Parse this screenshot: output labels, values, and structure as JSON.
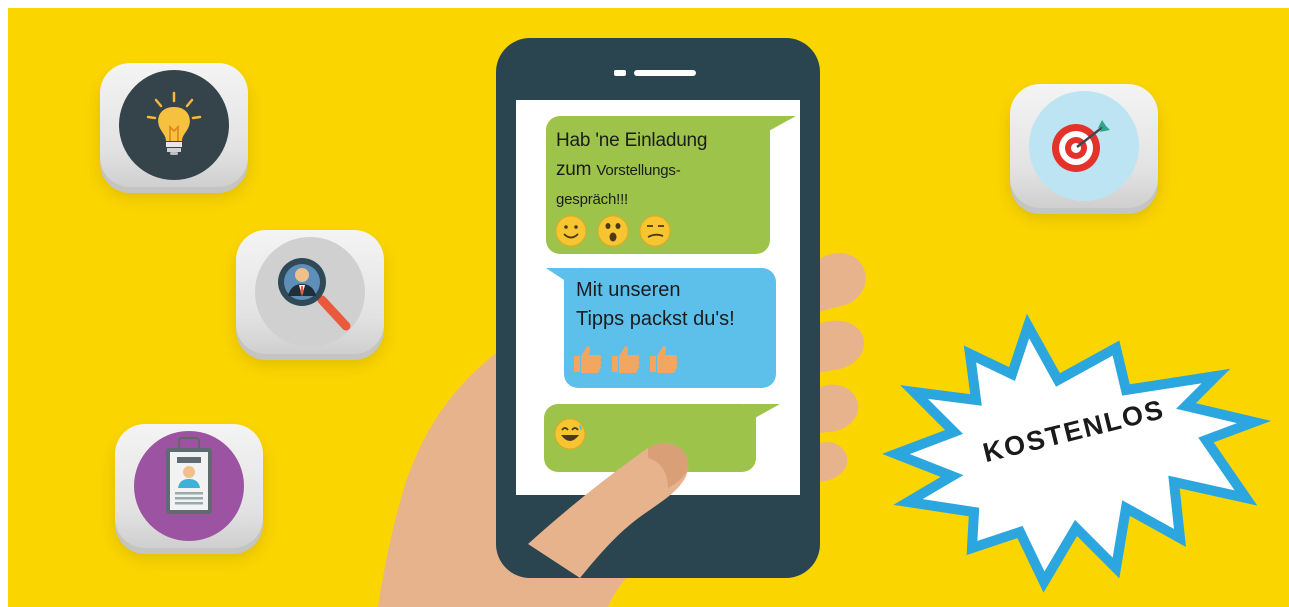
{
  "chat": {
    "message1": {
      "line1": "Hab 'ne Einladung",
      "line2a": "zum ",
      "line2b": "Vorstellungs-",
      "line3": "gespräch!!!"
    },
    "message2": {
      "line1": "Mit unseren",
      "line2": "Tipps packst du's!"
    }
  },
  "badge": {
    "label": "KOSTENLOS"
  },
  "icons": [
    "lightbulb-icon",
    "magnifier-person-icon",
    "id-badge-icon",
    "target-icon",
    "smiley-emoji",
    "surprised-emoji",
    "smirk-emoji",
    "thumbs-up-icon",
    "laughing-emoji"
  ],
  "colors": {
    "background": "#fbd500",
    "phone_body": "#2a4550",
    "green_bubble": "#9dc34a",
    "blue_bubble": "#5cc0ea",
    "burst_outline": "#2ba6df",
    "skin": "#e7b38c"
  }
}
